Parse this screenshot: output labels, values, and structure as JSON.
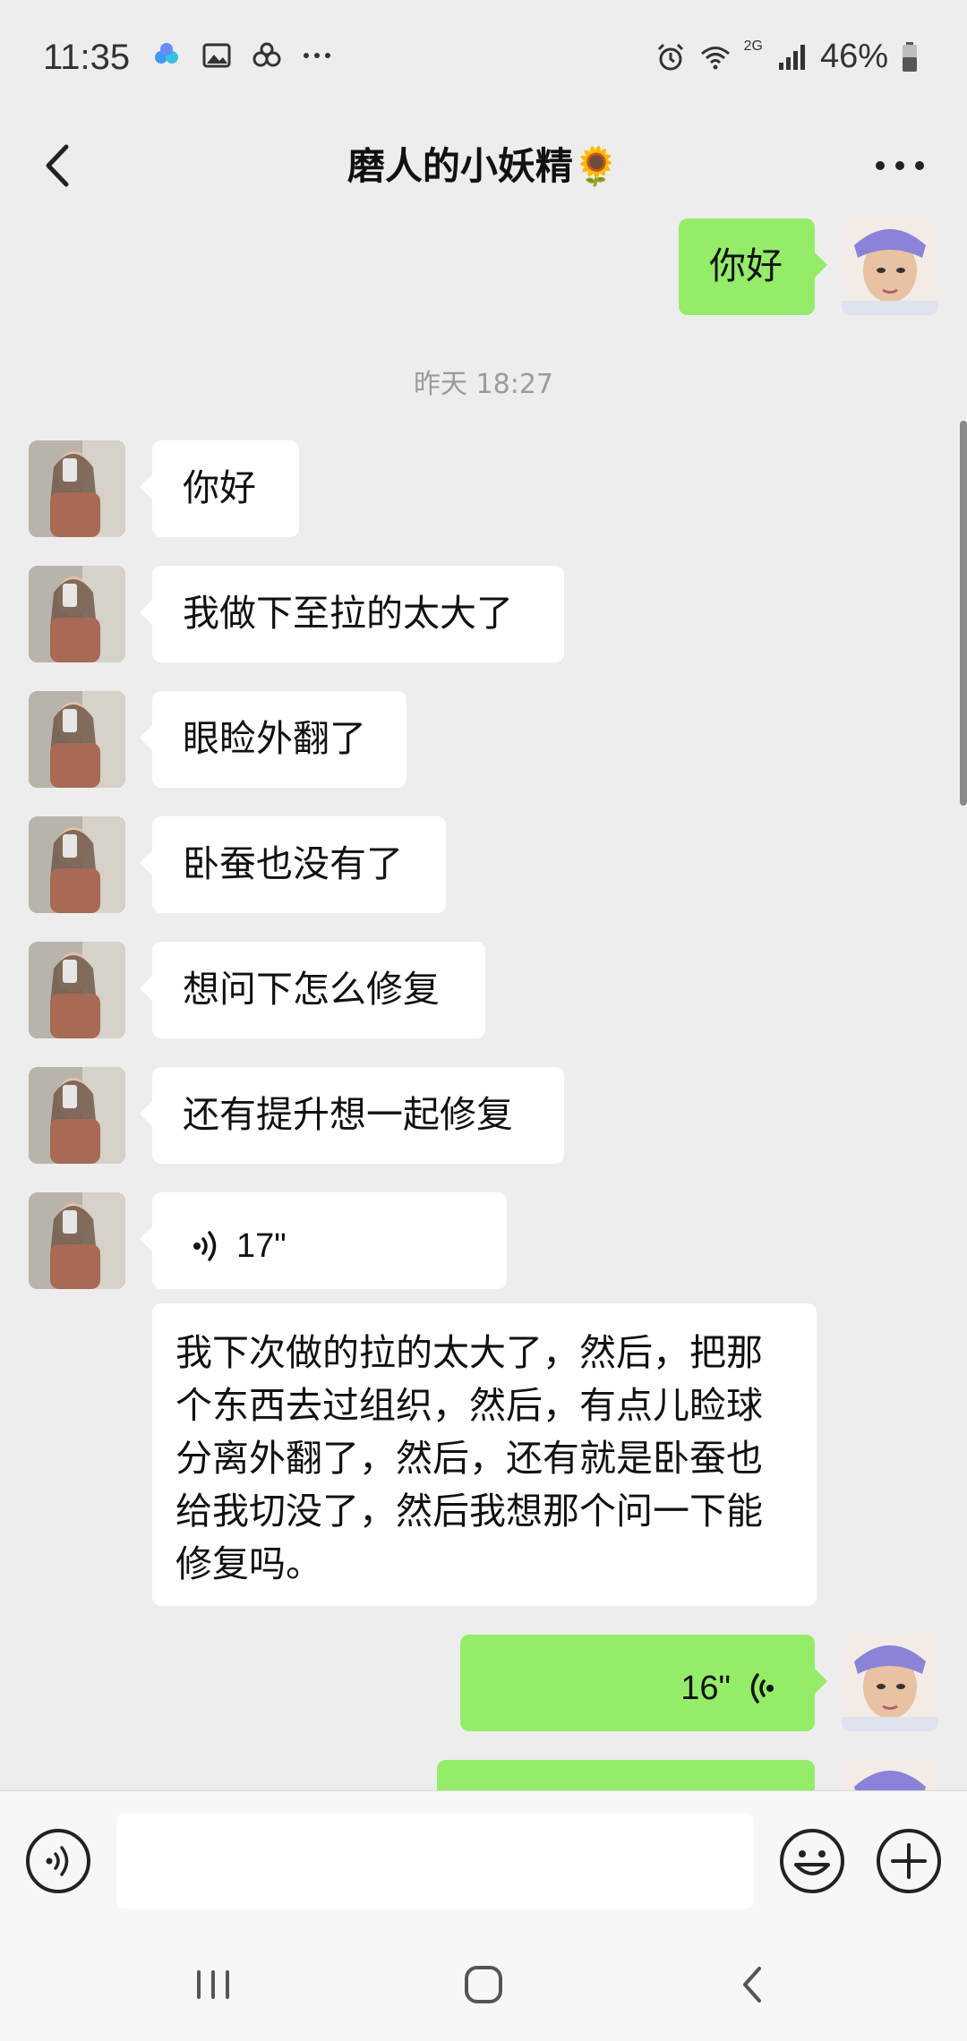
{
  "status_bar": {
    "time": "11:35",
    "left_icons": [
      "cloud-app-icon",
      "gallery-icon",
      "link-icon",
      "more-dots-icon"
    ],
    "right_icons": [
      "alarm-icon",
      "wifi-icon",
      "signal-icon"
    ],
    "network_label": "2G",
    "battery_text": "46%",
    "battery_level": 0.46
  },
  "header": {
    "title": "磨人的小妖精",
    "title_emoji": "🌻",
    "back_icon": "chevron-left-icon",
    "more_icon": "more-dots-icon"
  },
  "chat": {
    "messages": [
      {
        "side": "right",
        "type": "text",
        "text": "你好"
      },
      {
        "type": "timestamp",
        "text": "昨天 18:27"
      },
      {
        "side": "left",
        "type": "text",
        "text": "你好"
      },
      {
        "side": "left",
        "type": "text",
        "text": "我做下至拉的太大了"
      },
      {
        "side": "left",
        "type": "text",
        "text": "眼睑外翻了"
      },
      {
        "side": "left",
        "type": "text",
        "text": "卧蚕也没有了"
      },
      {
        "side": "left",
        "type": "text",
        "text": "想问下怎么修复"
      },
      {
        "side": "left",
        "type": "text",
        "text": "还有提升想一起修复"
      },
      {
        "side": "left",
        "type": "voice",
        "duration": "17\""
      },
      {
        "side": "left",
        "type": "transcript",
        "text": "我下次做的拉的太大了，然后，把那个东西去过组织，然后，有点儿睑球分离外翻了，然后，还有就是卧蚕也给我切没了，然后我想那个问一下能修复吗。"
      },
      {
        "side": "right",
        "type": "voice",
        "duration": "16\""
      },
      {
        "side": "right",
        "type": "text",
        "text": ""
      }
    ]
  },
  "input_bar": {
    "voice_icon": "voice-input-icon",
    "input_value": "",
    "emoji_icon": "emoji-icon",
    "plus_icon": "plus-icon"
  },
  "nav_bar": {
    "icons": [
      "recent-apps-icon",
      "home-icon",
      "back-icon"
    ]
  },
  "colors": {
    "background": "#ededed",
    "my_bubble": "#95ec69",
    "their_bubble": "#ffffff",
    "timestamp": "#9b9b9b"
  }
}
